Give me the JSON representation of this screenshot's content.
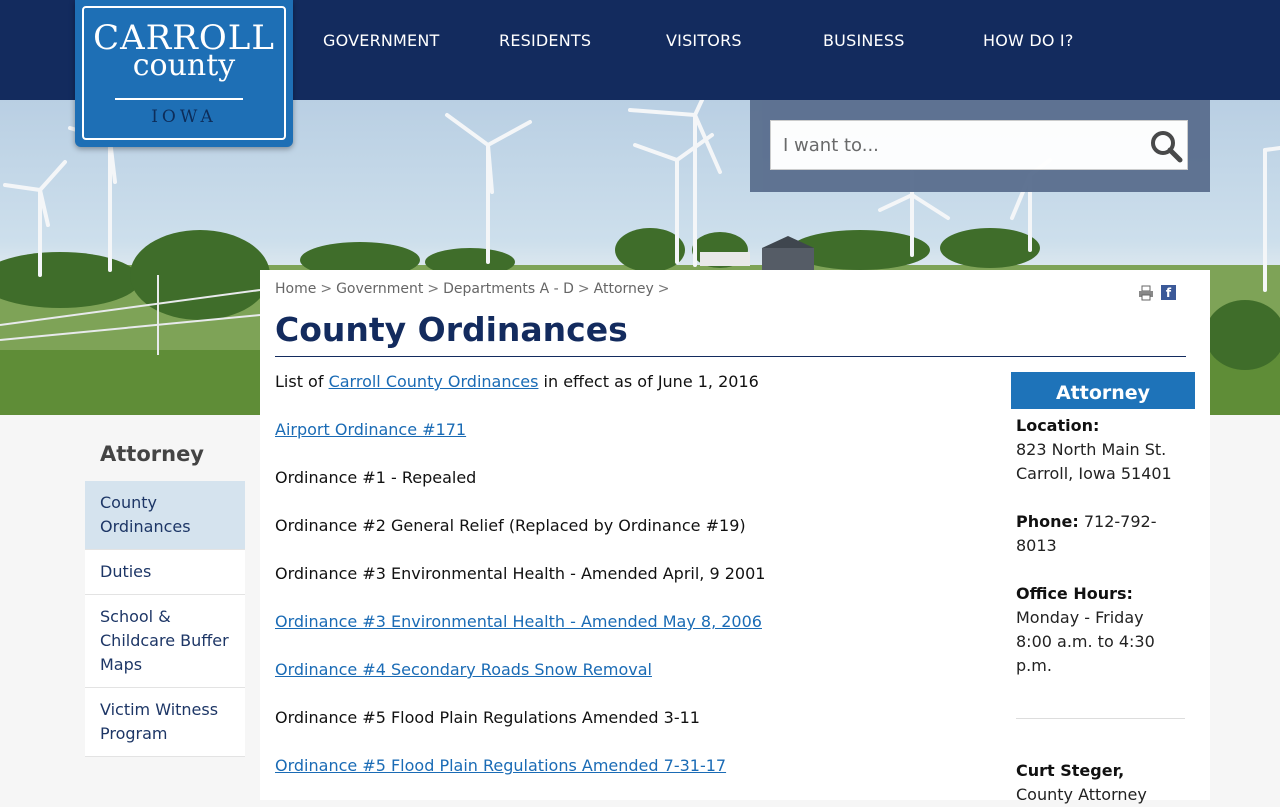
{
  "logo": {
    "line1": "CARROLL",
    "line2": "county",
    "line3": "IOWA"
  },
  "nav": {
    "items": [
      {
        "label": "GOVERNMENT"
      },
      {
        "label": "RESIDENTS"
      },
      {
        "label": "VISITORS"
      },
      {
        "label": "BUSINESS"
      },
      {
        "label": "HOW DO I?"
      }
    ]
  },
  "search": {
    "placeholder": "I want to..."
  },
  "breadcrumb": {
    "items": [
      "Home",
      "Government",
      "Departments A - D",
      "Attorney"
    ],
    "separator": ">"
  },
  "page": {
    "title": "County Ordinances"
  },
  "intro": {
    "prefix": "List of ",
    "link": "Carroll County Ordinances",
    "suffix": " in effect as of June 1, 2016"
  },
  "ordinances": [
    {
      "text": "Airport Ordinance #171",
      "link": true
    },
    {
      "text": "Ordinance #1 - Repealed",
      "link": false
    },
    {
      "text": "Ordinance #2 General Relief (Replaced by Ordinance #19)",
      "link": false
    },
    {
      "text": "Ordinance #3 Environmental Health - Amended April, 9 2001",
      "link": false
    },
    {
      "text": "Ordinance #3 Environmental Health - Amended May 8, 2006",
      "link": true
    },
    {
      "text": "Ordinance #4 Secondary Roads Snow Removal",
      "link": true
    },
    {
      "text": "Ordinance #5 Flood Plain Regulations Amended 3-11",
      "link": false
    },
    {
      "text": "Ordinance #5 Flood Plain Regulations Amended 7-31-17",
      "link": true
    }
  ],
  "info": {
    "heading": "Attorney",
    "location_label": "Location:",
    "address_line1": "823 North Main St.",
    "address_line2": "Carroll, Iowa 51401",
    "phone_label": "Phone:",
    "phone_part1": " 712-792-",
    "phone_part2": "8013",
    "hours_label": "Office Hours:",
    "hours_line1": "Monday - Friday",
    "hours_line2": "8:00 a.m. to 4:30",
    "hours_line3": "p.m.",
    "contact_name": "Curt Steger,",
    "contact_title": "County Attorney"
  },
  "sidebar": {
    "title": "Attorney",
    "items": [
      {
        "line1": "County",
        "line2": "Ordinances",
        "line3": ""
      },
      {
        "line1": "Duties",
        "line2": "",
        "line3": ""
      },
      {
        "line1": "School &",
        "line2": "Childcare Buffer",
        "line3": "Maps"
      },
      {
        "line1": "Victim Witness",
        "line2": "Program",
        "line3": ""
      }
    ]
  },
  "colors": {
    "header": "#132b5e",
    "logo": "#1e6fb5",
    "link": "#1a6bb5",
    "info_heading": "#1e73b9",
    "sidebar_active": "#d5e3ee"
  }
}
